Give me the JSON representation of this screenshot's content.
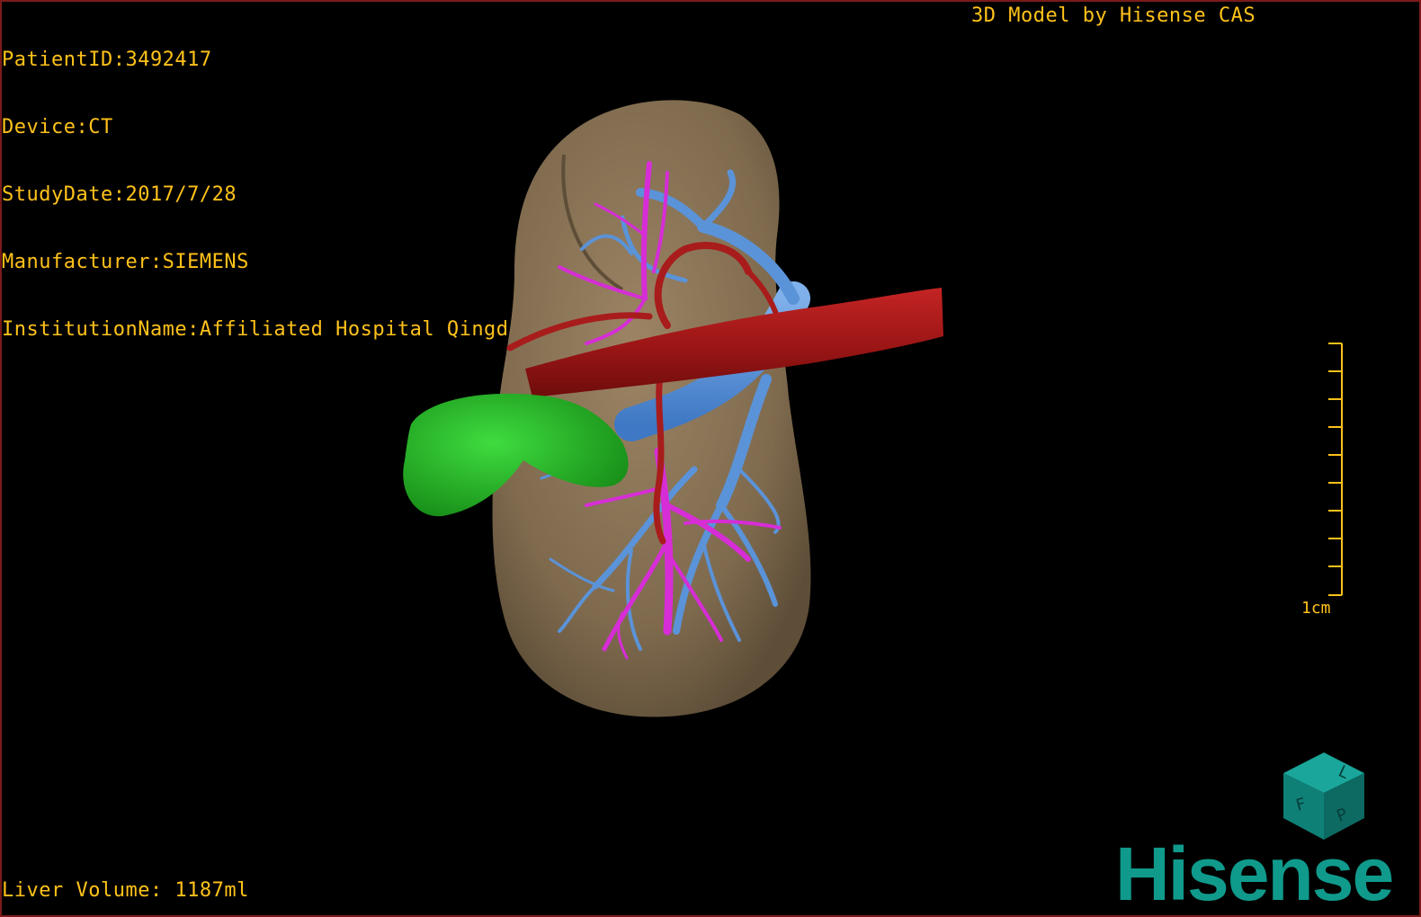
{
  "patient_info": {
    "patient_id": "PatientID:3492417",
    "device": "Device:CT",
    "study_date": "StudyDate:2017/7/28",
    "manufacturer": "Manufacturer:SIEMENS",
    "institution": "InstitutionName:Affiliated Hospital Qingdao University-C"
  },
  "model_title": "3D Model by Hisense CAS",
  "liver_volume": "Liver Volume: 1187ml",
  "scale_bar": {
    "label": "1cm"
  },
  "orientation_cube": {
    "faces": [
      "F",
      "L",
      "P"
    ],
    "icon": "orientation-cube-icon"
  },
  "brand": {
    "name": "Hisense"
  },
  "colors": {
    "overlay_text": "#ffc21a",
    "liver": "#8a7356",
    "portal_vein": "#5a93d8",
    "hepatic_vein": "#d62dd6",
    "artery": "#a81c1c",
    "gallbladder": "#22b522",
    "brand": "#0f9a8c"
  }
}
